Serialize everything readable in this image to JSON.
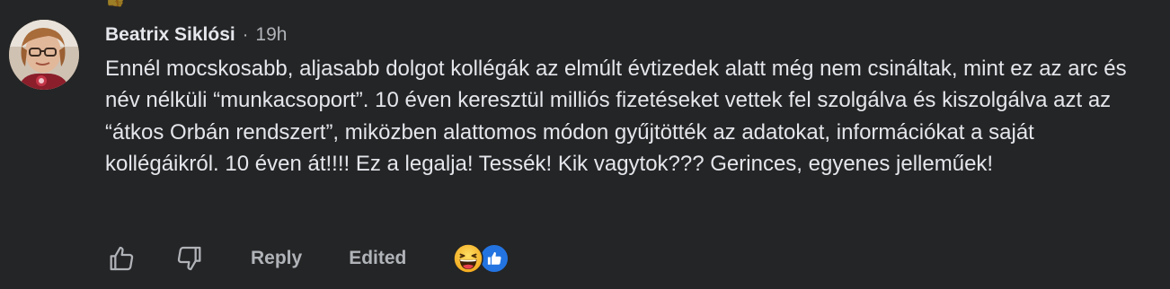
{
  "comment": {
    "author": "Beatrix Siklósi",
    "separator": "·",
    "timestamp": "19h",
    "text": "Ennél mocskosabb, aljasabb dolgot kollégák az elmúlt évtizedek alatt még nem csináltak, mint ez az arc és név nélküli “munkacsoport”. 10 éven keresztül milliós fizetéseket vettek fel szolgálva és kiszolgálva azt az “átkos Orbán rendszert”, miközben alattomos módon gyűjtötték az adatokat, információkat a saját kollégáikról. 10 éven át!!!! Ez a legalja! Tessék! Kik vagytok??? Gerinces, egyenes jelleműek!",
    "actions": {
      "reply_label": "Reply",
      "edited_label": "Edited"
    },
    "reactions": [
      "haha-emoji-icon",
      "like-reaction-icon"
    ],
    "colors": {
      "background": "#242526",
      "primary_text": "#e4e6eb",
      "secondary_text": "#b0b3b8",
      "like_blue": "#2374e1",
      "emoji_yellow": "#f7c13c"
    }
  }
}
